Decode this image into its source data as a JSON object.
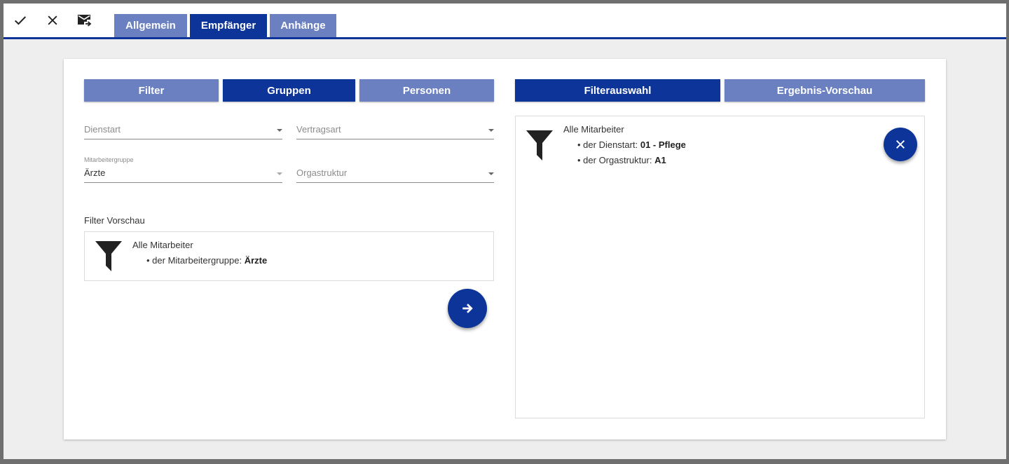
{
  "toolbar": {
    "confirm_icon": "check-icon",
    "cancel_icon": "close-icon",
    "send_icon": "mail-forward-icon"
  },
  "tabs": [
    {
      "label": "Allgemein",
      "active": false
    },
    {
      "label": "Empfänger",
      "active": true
    },
    {
      "label": "Anhänge",
      "active": false
    }
  ],
  "left_panel": {
    "segments": [
      {
        "label": "Filter",
        "active": false
      },
      {
        "label": "Gruppen",
        "active": true
      },
      {
        "label": "Personen",
        "active": false
      }
    ],
    "fields": {
      "dienstart": {
        "placeholder": "Dienstart",
        "value": ""
      },
      "vertragsart": {
        "placeholder": "Vertragsart",
        "value": ""
      },
      "mitarbeitergruppe": {
        "label": "Mitarbeitergruppe",
        "value": "Ärzte"
      },
      "orgastruktur": {
        "placeholder": "Orgastruktur",
        "value": ""
      }
    },
    "preview": {
      "heading": "Filter Vorschau",
      "title": "Alle Mitarbeiter",
      "items": [
        {
          "prefix": "der Mitarbeitergruppe:",
          "value": "Ärzte"
        }
      ]
    },
    "add_button_icon": "arrow-right-icon"
  },
  "right_panel": {
    "segments": [
      {
        "label": "Filterauswahl",
        "active": true
      },
      {
        "label": "Ergebnis-Vorschau",
        "active": false
      }
    ],
    "selection": {
      "title": "Alle Mitarbeiter",
      "items": [
        {
          "prefix": "der Dienstart:",
          "value": "01 - Pflege"
        },
        {
          "prefix": "der Orgastruktur:",
          "value": "A1"
        }
      ]
    },
    "remove_button_icon": "close-icon"
  },
  "colors": {
    "primary": "#0d3599",
    "primary_light": "#6a80c0",
    "background": "#eeeeee",
    "frame": "#6f6f6f"
  }
}
